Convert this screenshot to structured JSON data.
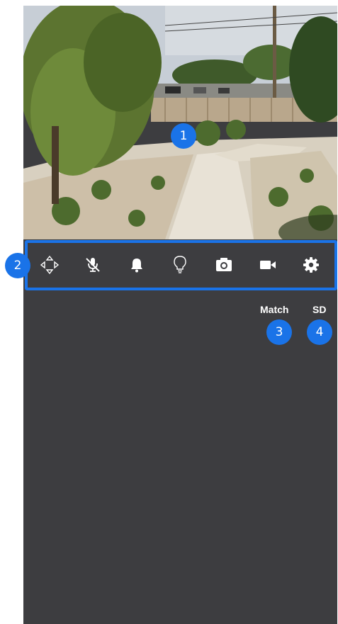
{
  "controls": {
    "items": [
      {
        "name": "pan-tilt",
        "icon": "pan-tilt-arrows-icon"
      },
      {
        "name": "mute",
        "icon": "microphone-muted-icon"
      },
      {
        "name": "alarm",
        "icon": "bell-icon"
      },
      {
        "name": "light",
        "icon": "lightbulb-icon"
      },
      {
        "name": "snapshot",
        "icon": "camera-icon"
      },
      {
        "name": "record",
        "icon": "video-camera-icon"
      },
      {
        "name": "settings",
        "icon": "gear-icon"
      }
    ]
  },
  "quality": {
    "match_label": "Match",
    "sd_label": "SD"
  },
  "callouts": {
    "one": "1",
    "two": "2",
    "three": "3",
    "four": "4"
  },
  "colors": {
    "background": "#3d3d40",
    "accent": "#1a73e8",
    "icon": "#ffffff"
  }
}
